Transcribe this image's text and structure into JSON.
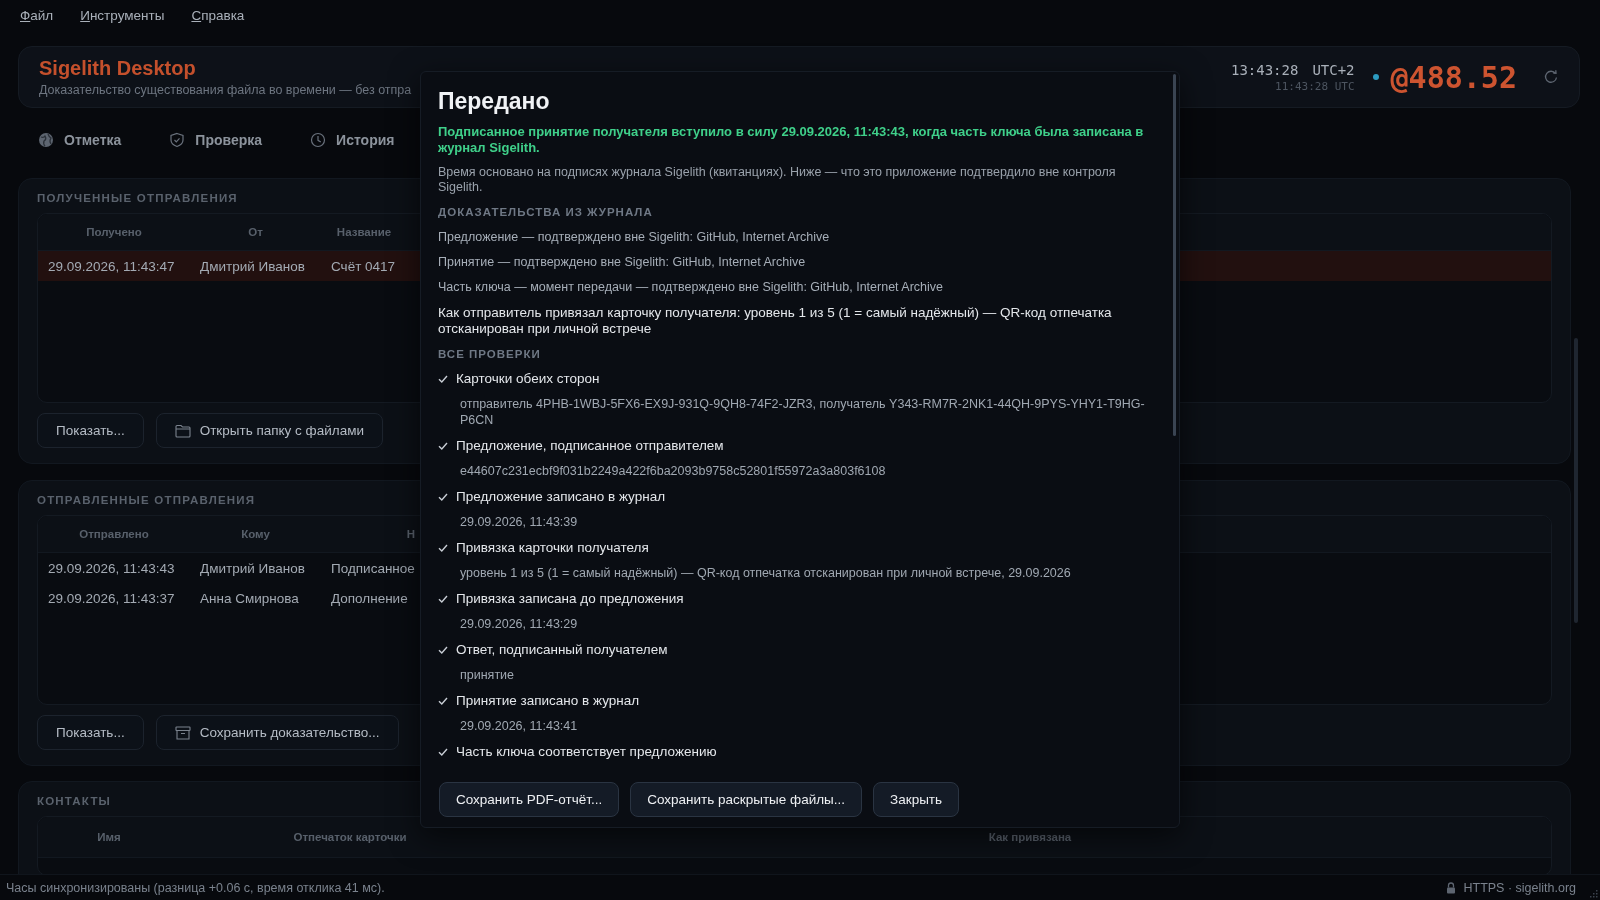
{
  "menu": [
    {
      "label": "Файл"
    },
    {
      "label": "Инструменты"
    },
    {
      "label": "Справка"
    }
  ],
  "app": {
    "title": "Sigelith Desktop",
    "subtitle": "Доказательство существования файла во времени — без отпра"
  },
  "clock": {
    "local_time": "13:43:28",
    "zone": "UTC+2",
    "utc_time": "11:43:28 UTC",
    "height": "@488.52"
  },
  "tabs": [
    {
      "label": "Отметка"
    },
    {
      "label": "Проверка"
    },
    {
      "label": "История"
    }
  ],
  "received": {
    "title": "ПОЛУЧЕННЫЕ ОТПРАВЛЕНИЯ",
    "columns": [
      "Получено",
      "От",
      "Название"
    ],
    "rows": [
      {
        "cells": [
          "29.09.2026, 11:43:47",
          "Дмитрий Иванов",
          "Счёт 0417"
        ],
        "selected": true
      }
    ],
    "buttons": [
      {
        "label": "Показать...",
        "kind": "plain"
      },
      {
        "label": "Открыть папку с файлами",
        "kind": "folder"
      }
    ]
  },
  "sent": {
    "title": "ОТПРАВЛЕННЫЕ ОТПРАВЛЕНИЯ",
    "columns": [
      "Отправлено",
      "Кому",
      "Н"
    ],
    "rows": [
      {
        "cells": [
          "29.09.2026, 11:43:43",
          "Дмитрий Иванов",
          "Подписанное"
        ],
        "selected": false
      },
      {
        "cells": [
          "29.09.2026, 11:43:37",
          "Анна Смирнова",
          "Дополнение"
        ],
        "selected": false
      }
    ],
    "buttons": [
      {
        "label": "Показать...",
        "kind": "plain"
      },
      {
        "label": "Сохранить доказательство...",
        "kind": "archive"
      }
    ]
  },
  "contacts": {
    "title": "КОНТАКТЫ",
    "columns": [
      "Имя",
      "Отпечаток карточки",
      "",
      "Как привязана"
    ]
  },
  "dialog": {
    "title": "Передано",
    "summary": "Подписанное принятие получателя вступило в силу 29.09.2026, 11:43:43, когда часть ключа была записана в журнал Sigelith.",
    "note": "Время основано на подписях журнала Sigelith (квитанциях). Ниже — что это приложение подтвердило вне контроля Sigelith.",
    "evidence_heading": "ДОКАЗАТЕЛЬСТВА ИЗ ЖУРНАЛА",
    "evidence": [
      "Предложение — подтверждено вне Sigelith: GitHub, Internet Archive",
      "Принятие — подтверждено вне Sigelith: GitHub, Internet Archive",
      "Часть ключа — момент передачи — подтверждено вне Sigelith: GitHub, Internet Archive"
    ],
    "binding": "Как отправитель привязал карточку получателя: уровень 1 из 5 (1 = самый надёжный) — QR-код отпечатка отсканирован при личной встрече",
    "checks_heading": "ВСЕ ПРОВЕРКИ",
    "checks": [
      {
        "label": "Карточки обеих сторон",
        "detail": "отправитель 4PHB-1WBJ-5FX6-EX9J-931Q-9QH8-74F2-JZR3, получатель Y343-RM7R-2NK1-44QH-9PYS-YHY1-T9HG-P6CN",
        "passed": true
      },
      {
        "label": "Предложение, подписанное отправителем",
        "detail": "e44607c231ecbf9f031b2249a422f6ba2093b9758c52801f55972a3a803f6108",
        "passed": true
      },
      {
        "label": "Предложение записано в журнал",
        "detail": "29.09.2026, 11:43:39",
        "passed": true
      },
      {
        "label": "Привязка карточки получателя",
        "detail": "уровень 1 из 5 (1 = самый надёжный) — QR-код отпечатка отсканирован при личной встрече, 29.09.2026",
        "passed": true
      },
      {
        "label": "Привязка записана до предложения",
        "detail": "29.09.2026, 11:43:29",
        "passed": true
      },
      {
        "label": "Ответ, подписанный получателем",
        "detail": "принятие",
        "passed": true
      },
      {
        "label": "Принятие записано в журнал",
        "detail": "29.09.2026, 11:43:41",
        "passed": true
      },
      {
        "label": "Часть ключа соответствует предложению",
        "passed": true
      }
    ],
    "buttons": [
      "Сохранить PDF-отчёт...",
      "Сохранить раскрытые файлы...",
      "Закрыть"
    ]
  },
  "status_bar": {
    "message": "Часы синхронизированы (разница +0.06 с, время отклика 41 мс).",
    "connection": "HTTPS · sigelith.org"
  }
}
